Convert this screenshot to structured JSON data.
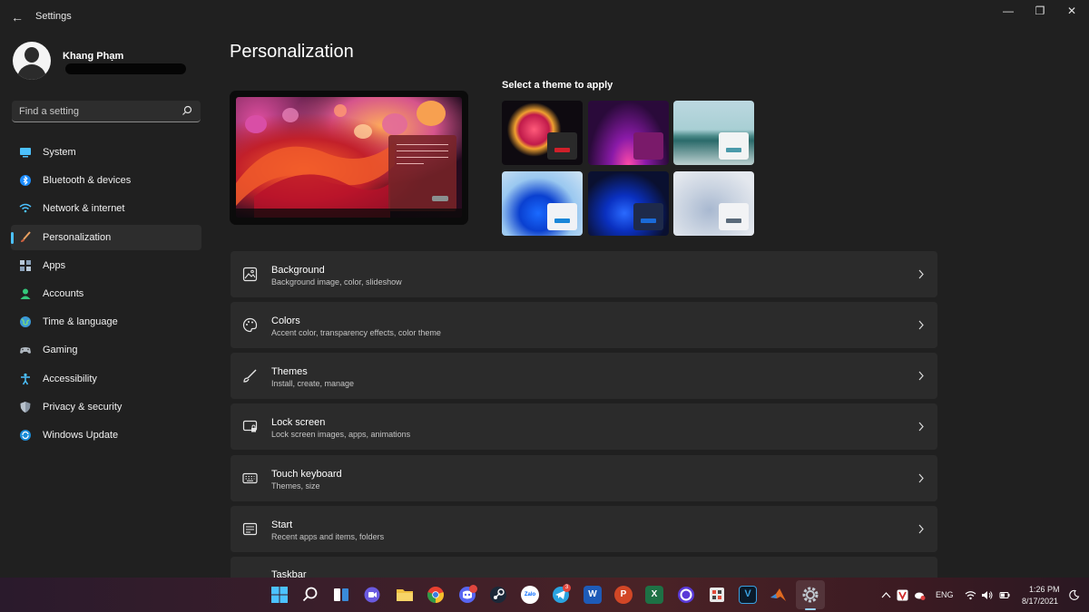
{
  "window": {
    "title": "Settings",
    "controls": {
      "minimize": "—",
      "maximize": "❐",
      "close": "✕"
    }
  },
  "profile": {
    "name": "Khang Phạm"
  },
  "search": {
    "placeholder": "Find a setting",
    "icon": "search-icon"
  },
  "sidebar": {
    "items": [
      {
        "label": "System",
        "icon": "monitor-icon",
        "active": false
      },
      {
        "label": "Bluetooth & devices",
        "icon": "bluetooth-icon",
        "active": false
      },
      {
        "label": "Network & internet",
        "icon": "wifi-icon",
        "active": false
      },
      {
        "label": "Personalization",
        "icon": "brush-icon",
        "active": true
      },
      {
        "label": "Apps",
        "icon": "apps-icon",
        "active": false
      },
      {
        "label": "Accounts",
        "icon": "person-icon",
        "active": false
      },
      {
        "label": "Time & language",
        "icon": "globe-icon",
        "active": false
      },
      {
        "label": "Gaming",
        "icon": "gamepad-icon",
        "active": false
      },
      {
        "label": "Accessibility",
        "icon": "accessibility-icon",
        "active": false
      },
      {
        "label": "Privacy & security",
        "icon": "shield-icon",
        "active": false
      },
      {
        "label": "Windows Update",
        "icon": "update-icon",
        "active": false
      }
    ]
  },
  "main": {
    "title": "Personalization",
    "themes": {
      "heading": "Select a theme to apply",
      "tiles": [
        {
          "name": "glow-dark",
          "accent": "#d0202a"
        },
        {
          "name": "purple-flow",
          "accent": "#7a1a6a"
        },
        {
          "name": "lake",
          "accent": "#4a9aaa"
        },
        {
          "name": "bloom-light",
          "accent": "#1a86d8"
        },
        {
          "name": "bloom-dark",
          "accent": "#1a6ad8"
        },
        {
          "name": "flow-light",
          "accent": "#5a6a7a"
        }
      ]
    },
    "settings": [
      {
        "title": "Background",
        "subtitle": "Background image, color, slideshow",
        "icon": "image-icon"
      },
      {
        "title": "Colors",
        "subtitle": "Accent color, transparency effects, color theme",
        "icon": "palette-icon"
      },
      {
        "title": "Themes",
        "subtitle": "Install, create, manage",
        "icon": "brush-icon"
      },
      {
        "title": "Lock screen",
        "subtitle": "Lock screen images, apps, animations",
        "icon": "lock-screen-icon"
      },
      {
        "title": "Touch keyboard",
        "subtitle": "Themes, size",
        "icon": "keyboard-icon"
      },
      {
        "title": "Start",
        "subtitle": "Recent apps and items, folders",
        "icon": "start-icon"
      },
      {
        "title": "Taskbar",
        "subtitle": "",
        "icon": "taskbar-icon"
      }
    ]
  },
  "taskbar": {
    "apps": [
      "windows-start-icon",
      "search-icon",
      "task-view-icon",
      "chat-icon",
      "file-explorer-icon",
      "chrome-icon",
      "discord-icon",
      "steam-icon",
      "zalo-icon",
      "telegram-icon",
      "word-icon",
      "powerpoint-icon",
      "excel-icon",
      "cortana-icon",
      "snipping-icon",
      "vscode-like-icon",
      "matlab-icon",
      "settings-icon"
    ],
    "badges": {
      "discord": "",
      "telegram": "3"
    },
    "zalo_label": "Zalo",
    "word_label": "W",
    "powerpoint_label": "P",
    "excel_label": "X",
    "v_label": "V",
    "tray": {
      "lang": "ENG",
      "time": "1:26 PM",
      "date": "8/17/2021"
    }
  }
}
